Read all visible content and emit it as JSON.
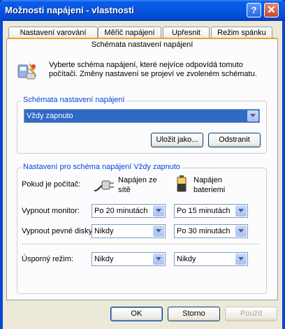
{
  "window": {
    "title": "Možnosti napájení - vlastnosti",
    "help_glyph": "?",
    "close_glyph": "✕"
  },
  "tabs": [
    {
      "label": "Nastavení varování"
    },
    {
      "label": "Měřič napájení"
    },
    {
      "label": "Upřesnit"
    },
    {
      "label": "Režim spánku"
    },
    {
      "label": "Schémata nastavení napájení"
    }
  ],
  "intro": {
    "text_line1": "Vyberte schéma napájení, které nejvíce odpovídá tomuto",
    "text_line2": "počítači. Změny nastavení se projeví ve zvoleném schématu."
  },
  "schemes_group": {
    "label": "Schémata nastavení napájení",
    "selected_scheme": "Vždy zapnuto",
    "save_as_label": "Uložit jako...",
    "delete_label": "Odstranit"
  },
  "settings_group": {
    "label": "Nastavení pro schéma napájení Vždy zapnuto",
    "when_label": "Pokud je počítač:",
    "plugged_in_label_1": "Napájen ze",
    "plugged_in_label_2": "sítě",
    "battery_label_1": "Napájen",
    "battery_label_2": "bateriemi",
    "rows": [
      {
        "label": "Vypnout monitor:",
        "ac": "Po 20 minutách",
        "dc": "Po 15 minutách"
      },
      {
        "label": "Vypnout pevné disky:",
        "ac": "Nikdy",
        "dc": "Po 30 minutách"
      },
      {
        "label": "Úsporný režim:",
        "ac": "Nikdy",
        "dc": "Nikdy"
      }
    ]
  },
  "footer": {
    "ok_label": "OK",
    "cancel_label": "Storno",
    "apply_label": "Použít"
  }
}
